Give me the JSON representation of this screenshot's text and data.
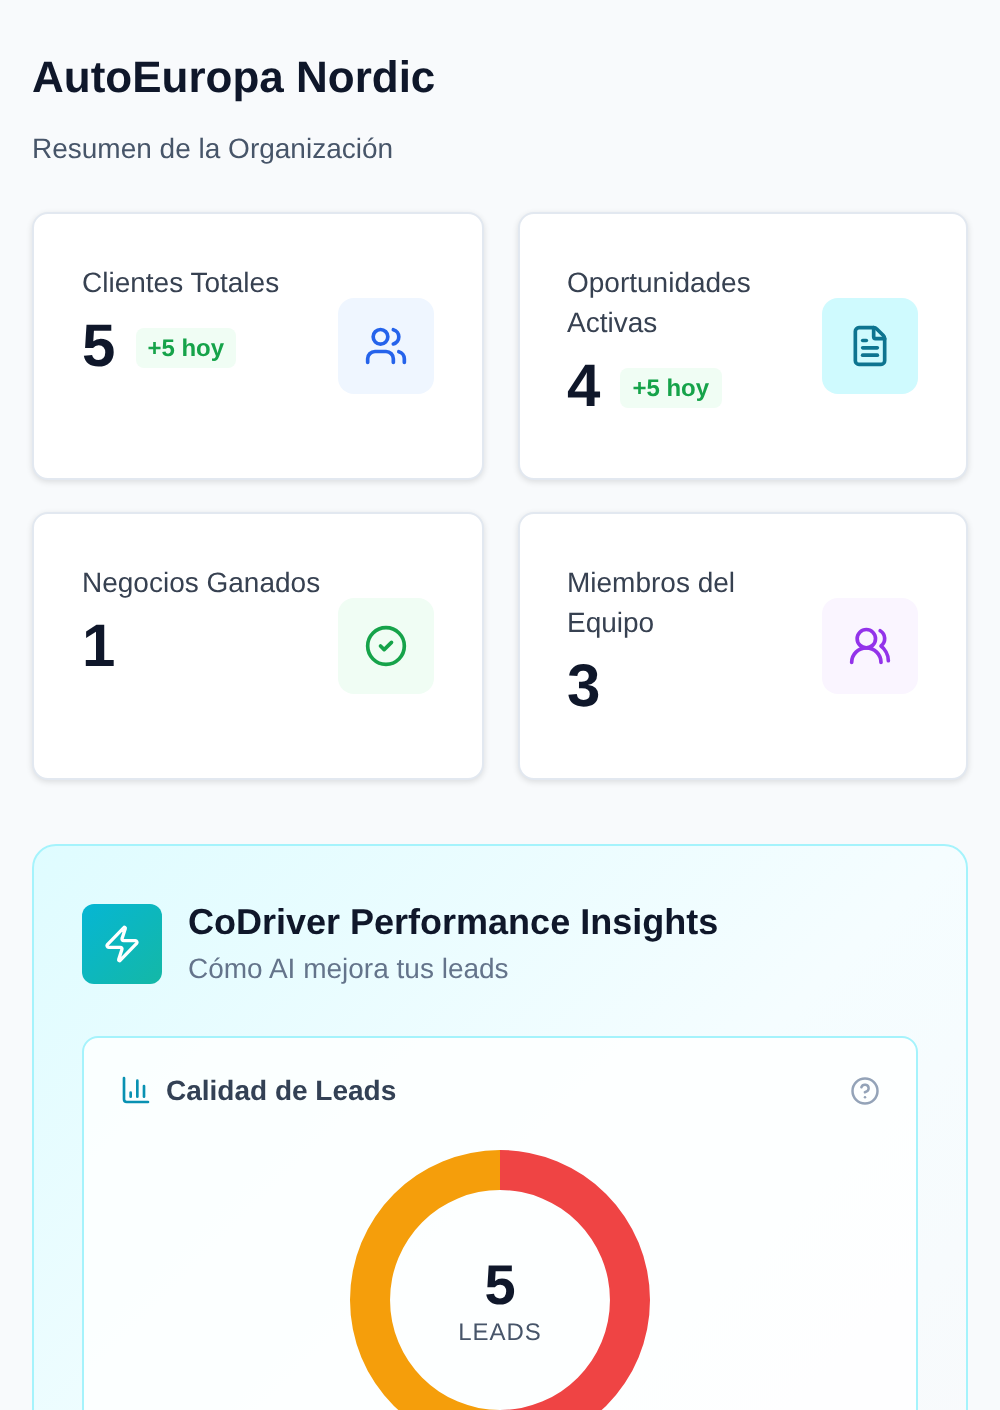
{
  "header": {
    "title": "AutoEuropa Nordic",
    "subtitle": "Resumen de la Organización"
  },
  "stats": [
    {
      "label": "Clientes Totales",
      "value": "5",
      "badge": "+5 hoy"
    },
    {
      "label": "Oportunidades Activas",
      "value": "4",
      "badge": "+5 hoy"
    },
    {
      "label": "Negocios Ganados",
      "value": "1"
    },
    {
      "label": "Miembros del Equipo",
      "value": "3"
    }
  ],
  "insights": {
    "title": "CoDriver Performance Insights",
    "subtitle": "Cómo AI mejora tus leads",
    "quality": {
      "title": "Calidad de Leads",
      "total": "5",
      "unit": "LEADS"
    }
  }
}
